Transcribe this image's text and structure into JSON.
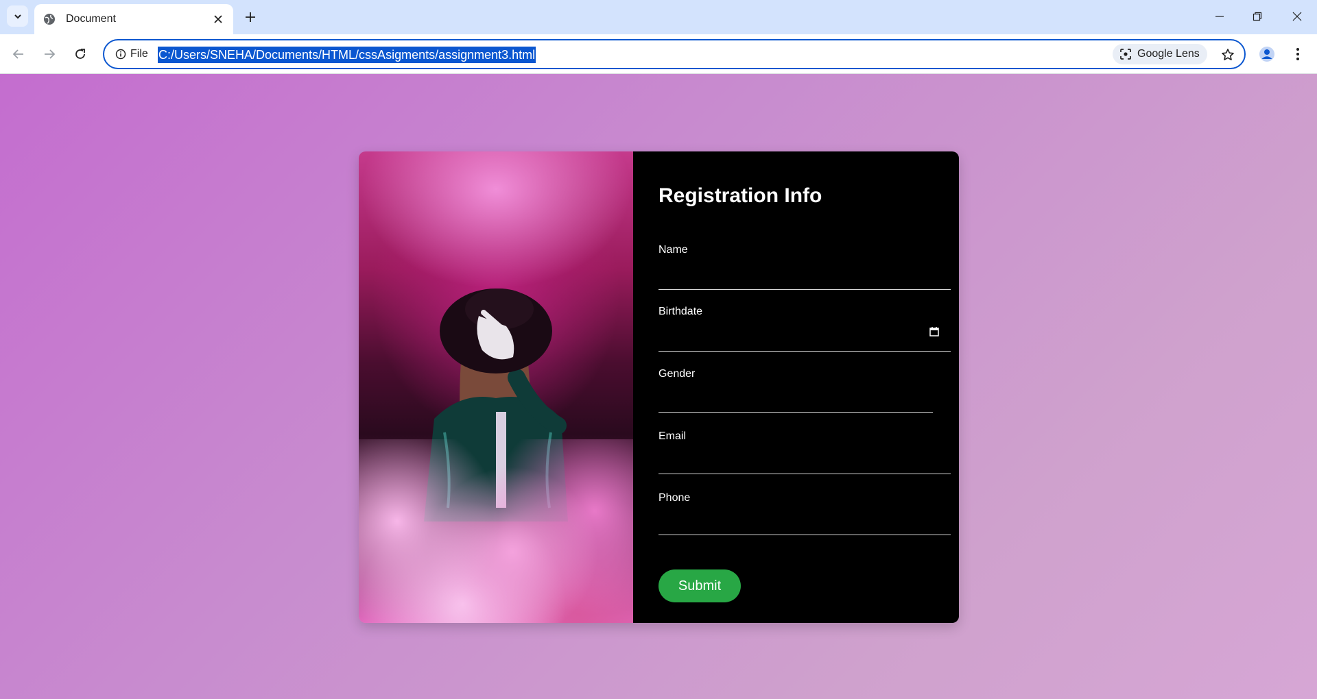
{
  "browser": {
    "tab_title": "Document",
    "site_info_label": "File",
    "url": "C:/Users/SNEHA/Documents/HTML/cssAsigments/assignment3.html",
    "lens_label": "Google Lens"
  },
  "form": {
    "title": "Registration Info",
    "fields": [
      {
        "label": "Name",
        "value": ""
      },
      {
        "label": "Birthdate",
        "value": ""
      },
      {
        "label": "Gender",
        "value": ""
      },
      {
        "label": "Email",
        "value": ""
      },
      {
        "label": "Phone",
        "value": ""
      }
    ],
    "submit_label": "Submit",
    "submit_color": "#28a745"
  },
  "colors": {
    "page_gradient_start": "#c46dcf",
    "page_gradient_end": "#d6a6d5",
    "panel": "#000000",
    "accent": "#0b57d0"
  },
  "icons": [
    "tab-search-icon",
    "globe-icon",
    "close-icon",
    "plus-icon",
    "minimize-icon",
    "restore-icon",
    "window-close-icon",
    "back-icon",
    "forward-icon",
    "reload-icon",
    "info-icon",
    "lens-icon",
    "star-icon",
    "profile-icon",
    "kebab-menu-icon",
    "calendar-icon"
  ]
}
